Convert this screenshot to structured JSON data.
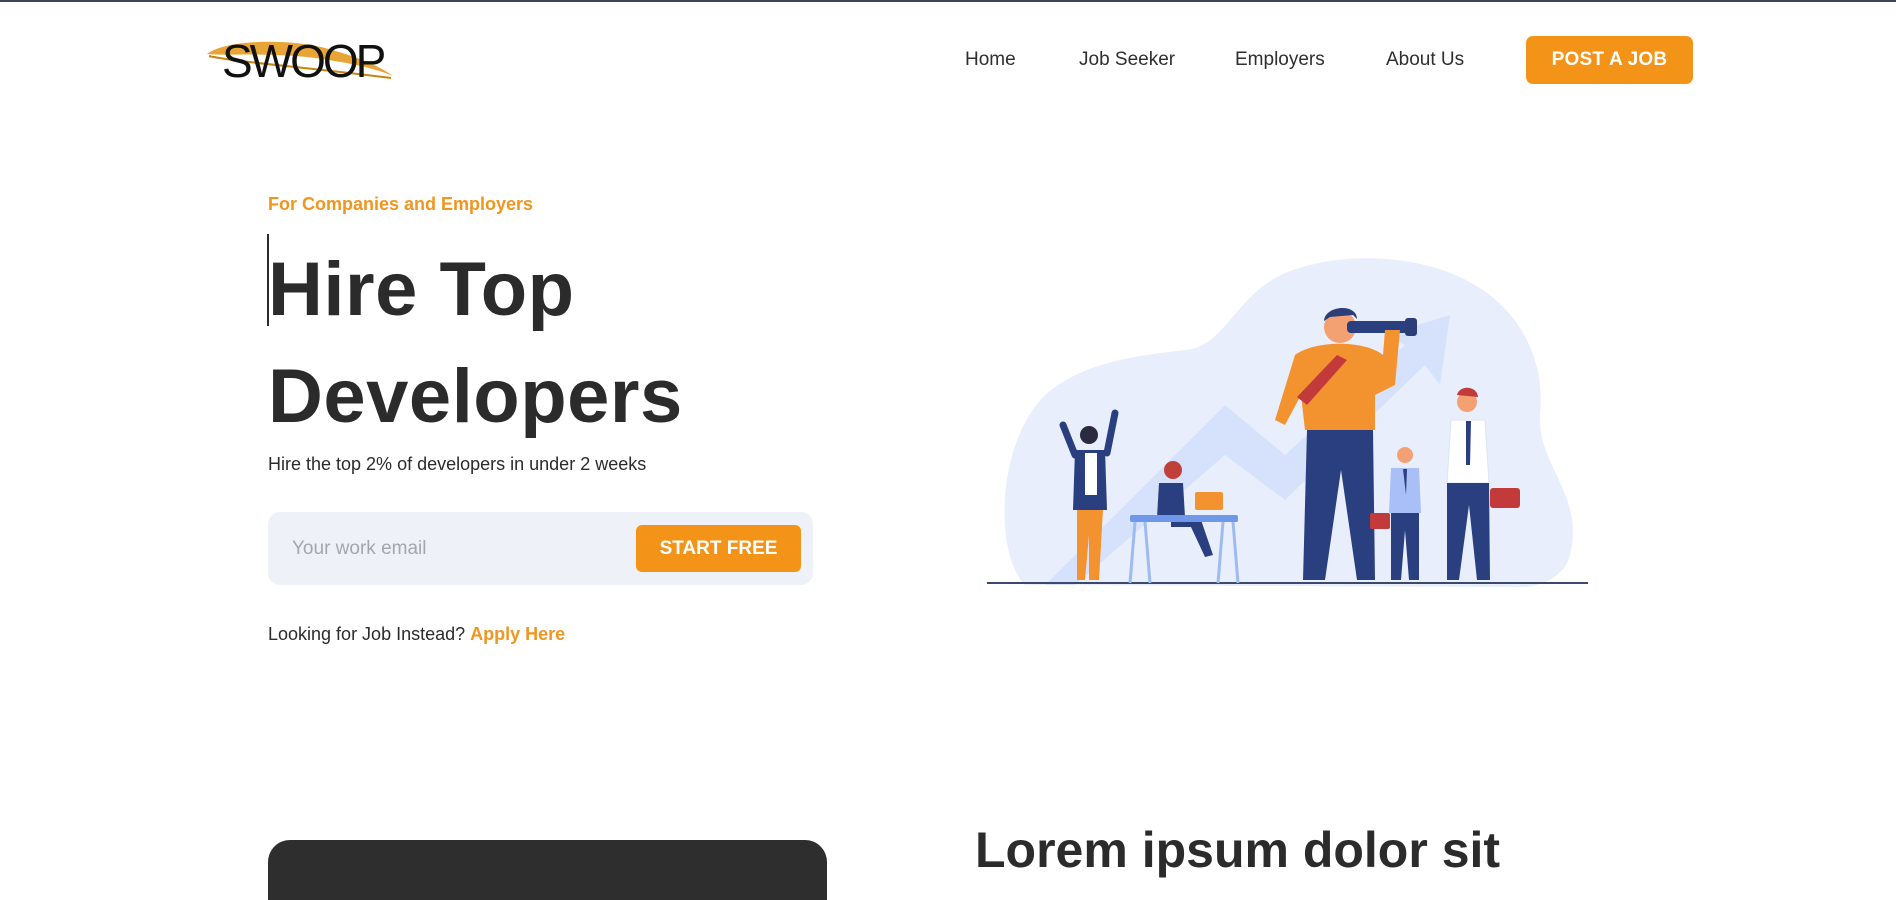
{
  "brand": {
    "logo_text": "SWOOP",
    "accent_color": "#f39317"
  },
  "nav": {
    "items": [
      {
        "label": "Home"
      },
      {
        "label": "Job Seeker"
      },
      {
        "label": "Employers"
      },
      {
        "label": "About Us"
      }
    ],
    "cta_label": "POST A JOB"
  },
  "hero": {
    "eyebrow": "For Companies and Employers",
    "title": "Hire Top Developers",
    "subtitle": "Hire the top 2% of developers in under 2 weeks",
    "email_placeholder": "Your work email",
    "email_value": "",
    "start_label": "START FREE",
    "job_prompt": "Looking for Job Instead?",
    "apply_label": "Apply Here"
  },
  "section2": {
    "title": "Lorem ipsum dolor sit"
  }
}
